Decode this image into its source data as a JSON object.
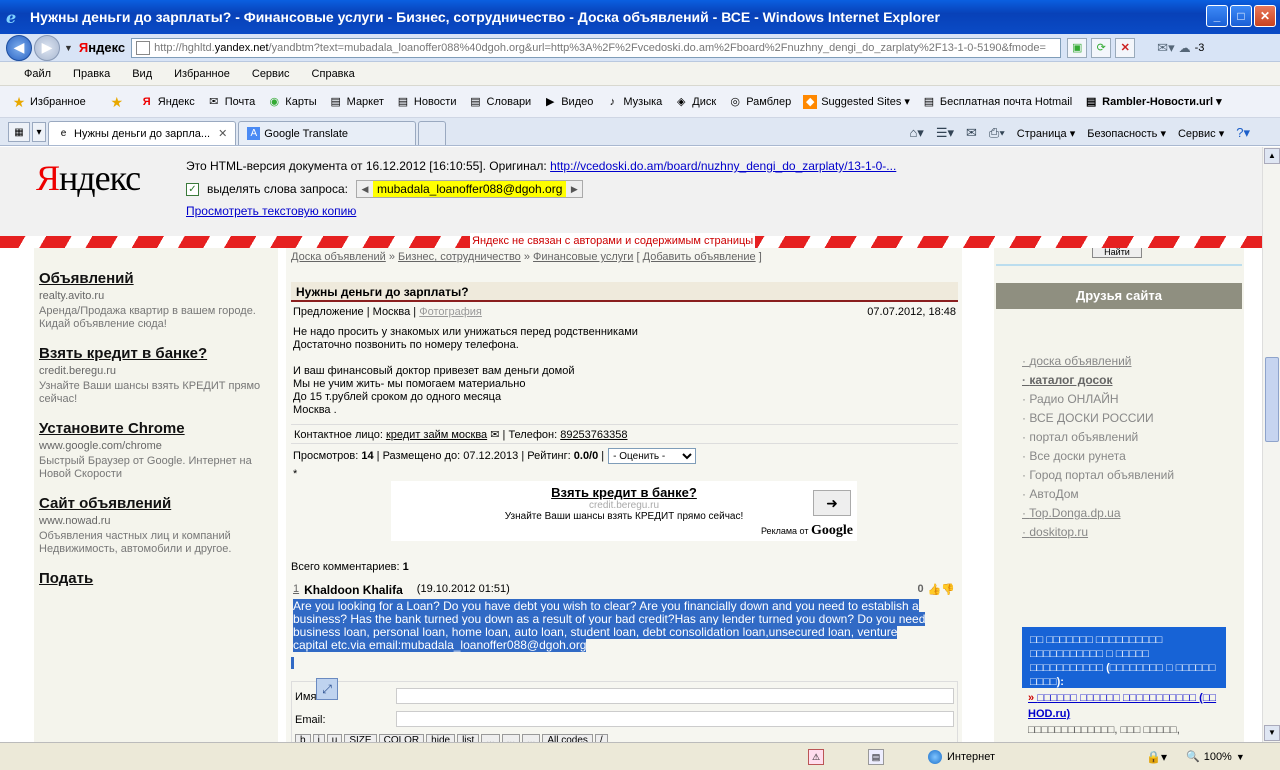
{
  "window": {
    "title": "Нужны деньги до зарплаты? - Финансовые услуги - Бизнес, сотрудничество - Доска объявлений - ВСЕ - Windows Internet Explorer"
  },
  "address": {
    "yandex_label": "Яндекс",
    "url_prefix": "http://hghltd.",
    "url_host": "yandex.net",
    "url_rest": "/yandbtm?text=mubadala_loanoffer088%40dgoh.org&url=http%3A%2F%2Fvcedoski.do.am%2Fboard%2Fnuzhny_dengi_do_zarplaty%2F13-1-0-5190&fmode=",
    "weather": "-3"
  },
  "menu": [
    "Файл",
    "Правка",
    "Вид",
    "Избранное",
    "Сервис",
    "Справка"
  ],
  "favorites": {
    "label": "Избранное",
    "items": [
      {
        "label": "Яндекс",
        "icon": "yandex-icon"
      },
      {
        "label": "Почта",
        "icon": "mail-icon"
      },
      {
        "label": "Карты",
        "icon": "maps-icon"
      },
      {
        "label": "Маркет",
        "icon": "market-icon"
      },
      {
        "label": "Новости",
        "icon": "news-icon"
      },
      {
        "label": "Словари",
        "icon": "dictionary-icon"
      },
      {
        "label": "Видео",
        "icon": "video-icon"
      },
      {
        "label": "Музыка",
        "icon": "music-icon"
      },
      {
        "label": "Диск",
        "icon": "disk-icon"
      },
      {
        "label": "Рамблер",
        "icon": "rambler-icon"
      },
      {
        "label": "Suggested Sites ▾",
        "icon": "suggested-icon"
      },
      {
        "label": "Бесплатная почта Hotmail",
        "icon": "hotmail-icon"
      },
      {
        "label": "Rambler-Новости.url ▾",
        "icon": "rambler-news-icon"
      }
    ]
  },
  "tabs": [
    {
      "label": "Нужны деньги до зарпла...",
      "active": true
    },
    {
      "label": "Google Translate",
      "active": false
    }
  ],
  "commandbar": [
    "Страница ▾",
    "Безопасность ▾",
    "Сервис ▾"
  ],
  "yandex_cache": {
    "logo": "Яндекс",
    "info_text": "Это HTML-версия документа от 16.12.2012 [16:10:55]. Оригинал:",
    "original_link": "http://vcedoski.do.am/board/nuzhny_dengi_do_zarplaty/13-1-0-...",
    "highlight_label": "выделять слова запроса:",
    "highlight_word": "mubadala_loanoffer088@dgoh.org",
    "text_copy_link": "Просмотреть текстовую копию",
    "disclaimer": "Яндекс не связан с авторами и содержимым страницы"
  },
  "left_ads": [
    {
      "title": "Объявлений",
      "url": "realty.avito.ru",
      "desc": "Аренда/Продажа квартир в вашем городе. Кидай объявление сюда!"
    },
    {
      "title": "Взять кредит в банке?",
      "url": "credit.beregu.ru",
      "desc": "Узнайте Ваши шансы взять КРЕДИТ прямо сейчас!"
    },
    {
      "title": "Установите Chrome",
      "url": "www.google.com/chrome",
      "desc": "Быстрый Браузер от Google. Интернет на Новой Скорости"
    },
    {
      "title": "Сайт объявлений",
      "url": "www.nowad.ru",
      "desc": "Объявления частных лиц и компаний Недвижимость, автомобили и другое."
    },
    {
      "title": "Подать",
      "url": "",
      "desc": ""
    }
  ],
  "breadcrumbs": {
    "items": [
      "Доска объявлений",
      "Бизнес, сотрудничество",
      "Финансовые услуги"
    ],
    "sep": "»",
    "add": "Добавить объявление"
  },
  "post": {
    "title": "Нужны деньги до зарплаты?",
    "type": "Предложение",
    "city": "Москва",
    "photo": "Фотография",
    "date": "07.07.2012, 18:48",
    "text": "Не надо просить у знакомых или унижаться перед родственниками\nДостаточно позвонить по номеру телефона.\n\nИ ваш финансовый доктор привезет вам деньги домой\nМы не учим жить- мы помогаем материально\nДо 15 т.рублей сроком до одного месяца\nМосква .",
    "contact_label": "Контактное лицо:",
    "contact_name": "кредит займ москва",
    "phone_label": "Телефон:",
    "phone": "89253763358",
    "views_label": "Просмотров:",
    "views": "14",
    "until_label": "Размещено до:",
    "until": "07.12.2013",
    "rating_label": "Рейтинг:",
    "rating": "0.0/0",
    "rate_option": "- Оценить -"
  },
  "google_ad": {
    "title": "Взять кредит в банке?",
    "url": "credit.beregu.ru",
    "desc": "Узнайте Ваши шансы взять КРЕДИТ прямо сейчас!",
    "by": "Реклама от",
    "google": "Google"
  },
  "comments": {
    "count_label": "Всего комментариев:",
    "count": "1",
    "items": [
      {
        "num": "1",
        "author": "Khaldoon Khalifa",
        "date": "(19.10.2012 01:51)",
        "rating": "0",
        "text": "Are you looking for a Loan? Do you have debt you wish to clear? Are you financially down and you need to establish a business? Has the bank turned you down as a result of your bad credit?Has any lender turned you down? Do you need business loan, personal loan, home loan, auto loan, student loan, debt consolidation loan,unsecured loan, venture capital etc.via email:mubadala_loanoffer088@dgoh.org"
      }
    ]
  },
  "comment_form": {
    "name_label": "Имя",
    "email_label": "Email:",
    "buttons": [
      "b",
      "i",
      "u",
      "SIZE",
      "COLOR",
      "hide",
      "list",
      "...",
      "...",
      "...",
      "All codes",
      "/"
    ]
  },
  "right": {
    "find_button": "Найти",
    "friends_title": "Друзья сайта",
    "links": [
      {
        "label": "доска объявлений",
        "style": "ul"
      },
      {
        "label": "каталог досок",
        "style": "b"
      },
      {
        "label": "Радио ОНЛАЙН",
        "style": ""
      },
      {
        "label": "ВСЕ ДОСКИ РОССИИ",
        "style": ""
      },
      {
        "label": "портал объявлений",
        "style": ""
      },
      {
        "label": "Все доски рунета",
        "style": ""
      },
      {
        "label": "Город портал объявлений",
        "style": ""
      },
      {
        "label": "АвтоДом",
        "style": ""
      },
      {
        "label": "Top.Donga.dp.ua",
        "style": "ul"
      },
      {
        "label": "doskitop.ru",
        "style": "ul"
      }
    ],
    "bluebox_text": "□□ □□□□□□□ □□□□□□□□□□ □□□□□□□□□□□ □ □□□□□ □□□□□□□□□□□ (□□□□□□□□ □ □□□□□□ □□□□):",
    "blue_link": "□□□□□□ □□□□□□ □□□□□□□□□□□ (□□ HOD.ru)",
    "blue_gray": "□□□□□□□□□□□□□, □□□ □□□□□,"
  },
  "status": {
    "zone": "Интернет",
    "zoom": "100%"
  }
}
